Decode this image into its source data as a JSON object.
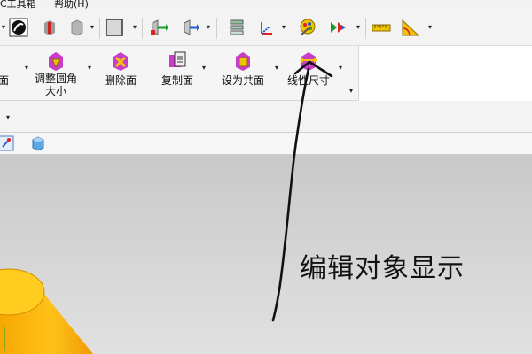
{
  "menubar": {
    "items": [
      "C工具箱",
      "帮助(H)"
    ]
  },
  "ribbon": {
    "items": [
      {
        "label": "面",
        "label2": ""
      },
      {
        "label": "调整圆角",
        "label2": "大小"
      },
      {
        "label": "删除面",
        "label2": ""
      },
      {
        "label": "复制面",
        "label2": ""
      },
      {
        "label": "设为共面",
        "label2": ""
      },
      {
        "label": "线性尺寸",
        "label2": ""
      }
    ]
  },
  "annotation": {
    "text": "编辑对象显示"
  },
  "colors": {
    "cone": "#f7b500",
    "viewport": "#d3d3d3",
    "toolbar": "#f3f3f3",
    "ink": "#111111"
  },
  "icons": [
    "display-mode-icon",
    "solid-shaded-icon",
    "wireframe-shade-icon",
    "view-style-icon",
    "move-component-icon",
    "assembly-icon",
    "layer-settings-icon",
    "coordinate-system-icon",
    "edit-object-display-icon",
    "show-hide-icon",
    "measure-distance-icon",
    "measure-angle-icon"
  ]
}
